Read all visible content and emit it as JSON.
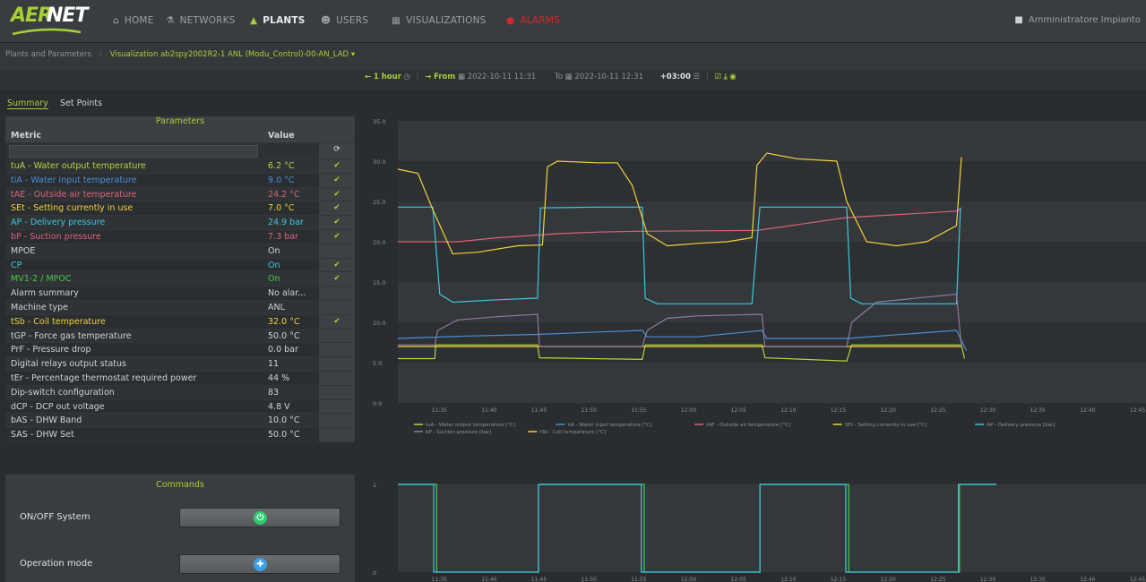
{
  "nav": {
    "logo": "AERNET",
    "items": [
      {
        "label": "HOME",
        "icon": "home-icon"
      },
      {
        "label": "NETWORKS",
        "icon": "sitemap-icon"
      },
      {
        "label": "PLANTS",
        "icon": "building-icon"
      },
      {
        "label": "USERS",
        "icon": "users-icon"
      },
      {
        "label": "VISUALIZATIONS",
        "icon": "chart-icon"
      },
      {
        "label": "ALARMS",
        "icon": "alarm-icon"
      }
    ],
    "user": "Amministratore Impianto"
  },
  "breadcrumb": {
    "label": "Plants and Parameters",
    "value": "Visualization ab2spy2002R2-1 ANL (Modu_Control)-00-AN_LAD"
  },
  "toolbar": {
    "range": "1 hour",
    "from_label": "From",
    "from_value": "2022-10-11 11:31",
    "to_label": "To",
    "to_value": "2022-10-11 12:31",
    "tz": "+03:00"
  },
  "tabs": {
    "summary": "Summary",
    "setpoints": "Set Points"
  },
  "parameters": {
    "title": "Parameters",
    "col_metric": "Metric",
    "col_value": "Value",
    "rows": [
      {
        "metric": "tuA - Water output temperature",
        "value": "6.2 °C",
        "color": "#b9d23b",
        "check": "✔"
      },
      {
        "metric": "tiA - Water input temperature",
        "value": "9.0 °C",
        "color": "#4a8fd9",
        "check": "✔"
      },
      {
        "metric": "tAE - Outside air temperature",
        "value": "24.2 °C",
        "color": "#d9627a",
        "check": "✔"
      },
      {
        "metric": "SEt - Setting currently in use",
        "value": "7.0 °C",
        "color": "#f0d23c",
        "check": "✔"
      },
      {
        "metric": "AP - Delivery pressure",
        "value": "24.9 bar",
        "color": "#3ec6e0",
        "check": "✔"
      },
      {
        "metric": "bP - Suction pressure",
        "value": "7.3 bar",
        "color": "#d9627a",
        "check": "✔"
      },
      {
        "metric": "MPOE",
        "value": "On",
        "color": "#cfd3d6",
        "check": ""
      },
      {
        "metric": "CP",
        "value": "On",
        "color": "#3ec6e0",
        "check": "✔"
      },
      {
        "metric": "MV1-2 / MPOC",
        "value": "On",
        "color": "#49c84a",
        "check": "✔"
      },
      {
        "metric": "Alarm summary",
        "value": "No alar...",
        "color": "#cfd3d6",
        "check": ""
      },
      {
        "metric": "Machine type",
        "value": "ANL",
        "color": "#cfd3d6",
        "check": ""
      },
      {
        "metric": "tSb - Coil temperature",
        "value": "32.0 °C",
        "color": "#f0d23c",
        "check": "✔"
      },
      {
        "metric": "tGP - Force gas temperature",
        "value": "50.0 °C",
        "color": "#cfd3d6",
        "check": ""
      },
      {
        "metric": "PrF - Pressure drop",
        "value": "0.0 bar",
        "color": "#cfd3d6",
        "check": ""
      },
      {
        "metric": "Digital relays output status",
        "value": "11",
        "color": "#cfd3d6",
        "check": ""
      },
      {
        "metric": "tEr - Percentage thermostat required power",
        "value": "44 %",
        "color": "#cfd3d6",
        "check": ""
      },
      {
        "metric": "Dip-switch configuration",
        "value": "83",
        "color": "#cfd3d6",
        "check": ""
      },
      {
        "metric": "dCP - DCP out voltage",
        "value": "4.8 V",
        "color": "#cfd3d6",
        "check": ""
      },
      {
        "metric": "bAS - DHW Band",
        "value": "10.0 °C",
        "color": "#cfd3d6",
        "check": ""
      },
      {
        "metric": "SAS - DHW Set",
        "value": "50.0 °C",
        "color": "#cfd3d6",
        "check": ""
      }
    ]
  },
  "commands": {
    "title": "Commands",
    "onoff_label": "ON/OFF System",
    "mode_label": "Operation mode",
    "onoff_color": "#2ecc71",
    "mode_color": "#3aa0e8"
  },
  "chart_data": [
    {
      "type": "line",
      "y_ticks": [
        "35.0",
        "30.0",
        "25.0",
        "20.0",
        "15.0",
        "10.0",
        "5.0",
        "0.0"
      ],
      "ylim": [
        0,
        35
      ],
      "x_ticks": [
        "11:35",
        "11:40",
        "11:45",
        "11:50",
        "11:55",
        "12:00",
        "12:05",
        "12:10",
        "12:15",
        "12:20",
        "12:25",
        "12:30",
        "12:35",
        "12:40",
        "12:45"
      ],
      "x_range": [
        "11:31",
        "12:46"
      ],
      "series": [
        {
          "name": "tuA - Water output temperature [°C]",
          "color": "#b9d23b",
          "points": [
            [
              0,
              5.5
            ],
            [
              3.7,
              5.5
            ],
            [
              3.8,
              7.2
            ],
            [
              14,
              7.2
            ],
            [
              14.2,
              5.6
            ],
            [
              24.5,
              5.4
            ],
            [
              24.8,
              7.2
            ],
            [
              36.5,
              7.2
            ],
            [
              36.8,
              5.6
            ],
            [
              45,
              5.2
            ],
            [
              45.5,
              7.2
            ],
            [
              56.5,
              7.2
            ],
            [
              56.8,
              5.5
            ]
          ]
        },
        {
          "name": "tiA - Water input temperature [°C]",
          "color": "#4a8fd9",
          "points": [
            [
              0,
              8.0
            ],
            [
              7,
              8.3
            ],
            [
              14,
              8.5
            ],
            [
              20,
              8.8
            ],
            [
              24.5,
              9.0
            ],
            [
              25,
              8.2
            ],
            [
              30,
              8.2
            ],
            [
              36.5,
              9.0
            ],
            [
              37,
              8.0
            ],
            [
              45,
              8.0
            ],
            [
              56,
              9.0
            ],
            [
              57,
              6.5
            ]
          ]
        },
        {
          "name": "tAE - Outside air temperature [°C]",
          "color": "#d9627a",
          "points": [
            [
              0,
              20
            ],
            [
              6,
              20
            ],
            [
              10,
              20.5
            ],
            [
              16,
              21
            ],
            [
              20,
              21.2
            ],
            [
              24,
              21.3
            ],
            [
              36,
              21.4
            ],
            [
              45,
              23
            ],
            [
              56,
              23.8
            ],
            [
              56.5,
              24.2
            ]
          ]
        },
        {
          "name": "SEt - Setting currently in use [°C]",
          "color": "#f0d23c",
          "points": [
            [
              0,
              7.0
            ],
            [
              56.5,
              7.0
            ]
          ]
        },
        {
          "name": "AP - Delivery pressure [bar]",
          "color": "#3ec6e0",
          "points": [
            [
              0,
              24.3
            ],
            [
              3.5,
              24.3
            ],
            [
              4.2,
              13.5
            ],
            [
              5.5,
              12.5
            ],
            [
              10,
              12.8
            ],
            [
              14,
              13
            ],
            [
              14.3,
              24.2
            ],
            [
              20,
              24.3
            ],
            [
              24.5,
              24.3
            ],
            [
              24.8,
              13
            ],
            [
              26,
              12.3
            ],
            [
              35.5,
              12.3
            ],
            [
              36.3,
              24.3
            ],
            [
              45,
              24.3
            ],
            [
              45.4,
              13
            ],
            [
              46.5,
              12.3
            ],
            [
              56,
              12.3
            ],
            [
              56.4,
              24.2
            ]
          ]
        },
        {
          "name": "bP - Suction pressure [bar]",
          "color": "#8e7aa0",
          "points": [
            [
              0,
              7.2
            ],
            [
              3.7,
              7.2
            ],
            [
              4,
              9
            ],
            [
              6,
              10.3
            ],
            [
              10,
              10.7
            ],
            [
              14,
              11
            ],
            [
              14.2,
              7
            ],
            [
              24.5,
              7
            ],
            [
              25,
              9
            ],
            [
              27,
              10.5
            ],
            [
              30,
              10.8
            ],
            [
              36.5,
              11
            ],
            [
              36.8,
              7
            ],
            [
              45,
              7
            ],
            [
              45.5,
              10
            ],
            [
              48,
              12.5
            ],
            [
              56,
              13.5
            ],
            [
              56.5,
              7
            ]
          ]
        },
        {
          "name": "tSb - Coil temperature [°C]",
          "color": "#f0d23c",
          "points": [
            [
              0,
              29
            ],
            [
              2,
              28.5
            ],
            [
              3.5,
              24
            ],
            [
              5.5,
              18.5
            ],
            [
              8,
              18.7
            ],
            [
              12,
              19.5
            ],
            [
              14.5,
              19.6
            ],
            [
              15,
              29.3
            ],
            [
              16,
              30
            ],
            [
              20,
              29.8
            ],
            [
              22,
              29.8
            ],
            [
              23.5,
              27
            ],
            [
              25,
              21
            ],
            [
              27,
              19.5
            ],
            [
              30,
              19.8
            ],
            [
              33,
              20
            ],
            [
              35.5,
              20.5
            ],
            [
              36,
              29.5
            ],
            [
              37,
              31
            ],
            [
              40,
              30.3
            ],
            [
              44,
              30
            ],
            [
              45,
              25
            ],
            [
              47,
              20
            ],
            [
              50,
              19.5
            ],
            [
              53,
              20
            ],
            [
              56,
              22
            ],
            [
              56.5,
              30.5
            ]
          ]
        }
      ]
    },
    {
      "type": "line",
      "y_ticks": [
        "1",
        "0"
      ],
      "ylim": [
        0,
        1
      ],
      "x_ticks": [
        "11:35",
        "11:40",
        "11:45",
        "11:50",
        "11:55",
        "12:00",
        "12:05",
        "12:10",
        "12:15",
        "12:20",
        "12:25",
        "12:30",
        "12:35",
        "12:40",
        "12:45"
      ],
      "x_range": [
        "11:31",
        "12:46"
      ],
      "series": [
        {
          "name": "MV1-2 / MPOC",
          "color": "#49c84a",
          "points": [
            [
              0,
              1
            ],
            [
              3.9,
              1
            ],
            [
              3.9,
              0
            ],
            [
              14.1,
              0
            ],
            [
              14.1,
              1
            ],
            [
              24.7,
              1
            ],
            [
              24.7,
              0
            ],
            [
              36.3,
              0
            ],
            [
              36.3,
              1
            ],
            [
              45.2,
              1
            ],
            [
              45.2,
              0
            ],
            [
              56.3,
              0
            ],
            [
              56.3,
              1
            ],
            [
              60,
              1
            ]
          ]
        },
        {
          "name": "CP",
          "color": "#3ec6e0",
          "points": [
            [
              0,
              1
            ],
            [
              3.6,
              1
            ],
            [
              3.6,
              0
            ],
            [
              14.1,
              0
            ],
            [
              14.1,
              1
            ],
            [
              24.4,
              1
            ],
            [
              24.4,
              0
            ],
            [
              36.3,
              0
            ],
            [
              36.3,
              1
            ],
            [
              44.9,
              1
            ],
            [
              44.9,
              0
            ],
            [
              56.2,
              0
            ],
            [
              56.2,
              1
            ],
            [
              60,
              1
            ]
          ]
        }
      ]
    }
  ]
}
